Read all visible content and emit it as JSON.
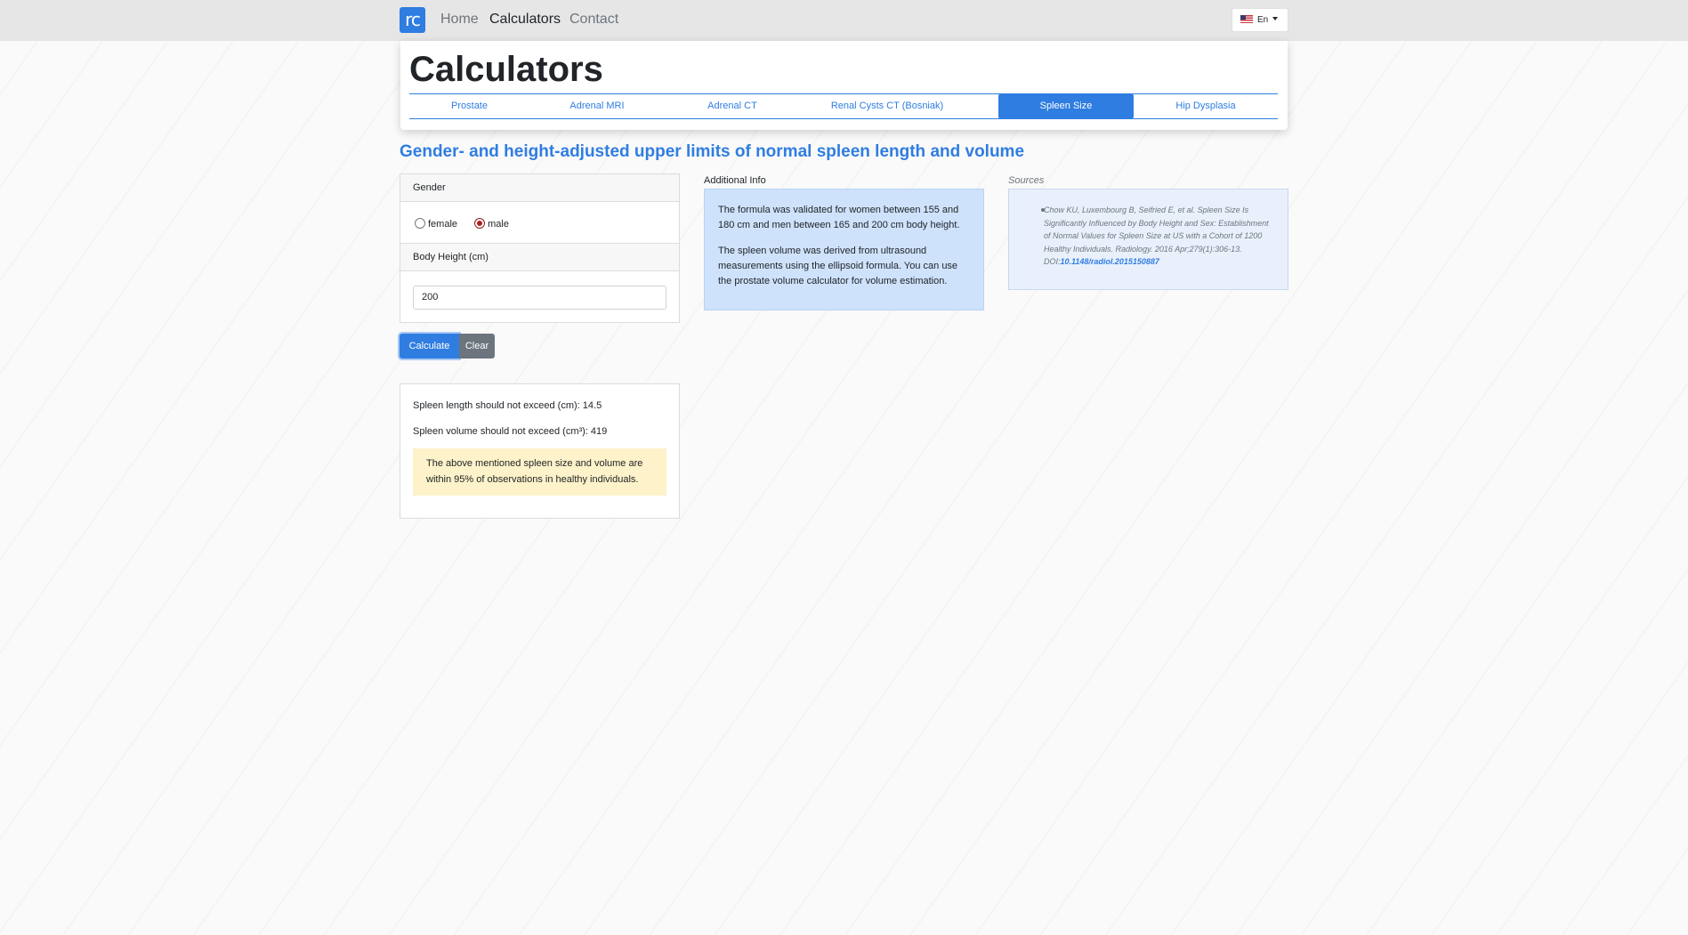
{
  "nav": {
    "logo": "rc",
    "home": "Home",
    "calculators": "Calculators",
    "contact": "Contact",
    "language": "En"
  },
  "header": {
    "title": "Calculators",
    "tabs": [
      "Prostate",
      "Adrenal MRI",
      "Adrenal CT",
      "Renal Cysts CT (Bosniak)",
      "Spleen Size",
      "Hip Dysplasia"
    ],
    "active_tab": "Spleen Size"
  },
  "heading": "Gender- and height-adjusted upper limits of normal spleen length and volume",
  "form": {
    "gender_label": "Gender",
    "female": "female",
    "male": "male",
    "selected_gender": "male",
    "height_label": "Body Height (cm)",
    "height_value": "200",
    "calculate": "Calculate",
    "clear": "Clear"
  },
  "result": {
    "length_line": "Spleen length should not exceed (cm): 14.5",
    "volume_line": "Spleen volume should not exceed (cm³): 419",
    "note": "The above mentioned spleen size and volume are within 95% of observations in healthy individuals."
  },
  "info": {
    "label": "Additional Info",
    "p1": "The formula was validated for women between 155 and 180 cm and men between 165 and 200 cm body height.",
    "p2": "The spleen volume was derived from ultrasound measurements using the ellipsoid formula. You can use the prostate volume calculator for volume estimation."
  },
  "sources": {
    "label": "Sources",
    "citation": "Chow KU, Luxembourg B, Seifried E, et al. Spleen Size Is Significantly Influenced by Body Height and Sex: Establishment of Normal Values for Spleen Size at US with a Cohort of 1200 Healthy Individuals. Radiology. 2016 Apr;279(1):306-13. DOI:",
    "doi": "10.1148/radiol.2015150887"
  },
  "colors": {
    "accent": "#2f7de1",
    "navbar": "#e6e6e6",
    "info_bg": "#cfe2fc",
    "note_bg": "#fdf2c9"
  }
}
